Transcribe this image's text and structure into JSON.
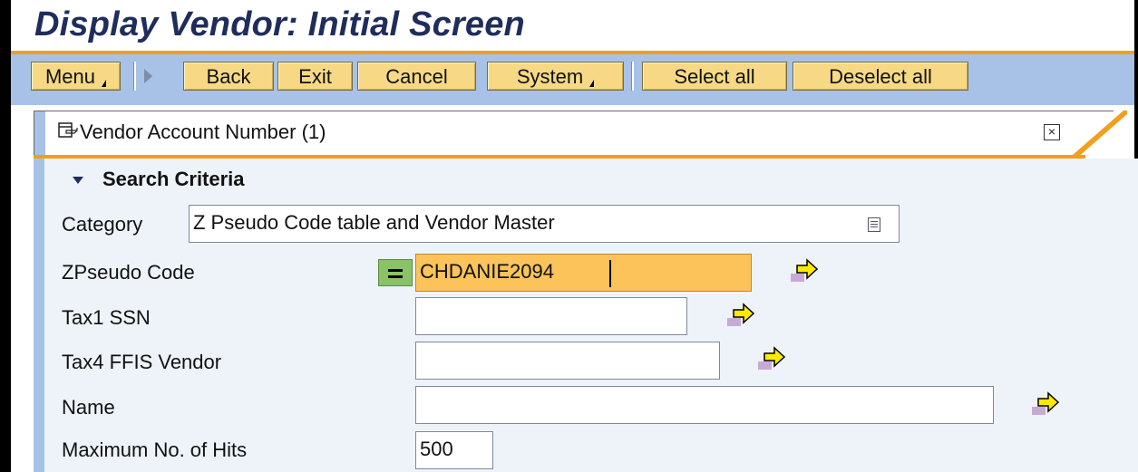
{
  "window": {
    "title": "Display Vendor: Initial Screen"
  },
  "toolbar": {
    "menu_label": "Menu",
    "back_label": "Back",
    "exit_label": "Exit",
    "cancel_label": "Cancel",
    "system_label": "System",
    "select_all_label": "Select all",
    "deselect_all_label": "Deselect all"
  },
  "panel": {
    "header_title": "Vendor Account Number (1)",
    "close_glyph": "×",
    "section_title": "Search Criteria"
  },
  "form": {
    "category_label": "Category",
    "category_value": "Z Pseudo Code table and Vendor Master",
    "zpseudo_label": "ZPseudo Code",
    "zpseudo_value": "CHDANIE2094",
    "tax1_label": "Tax1 SSN",
    "tax1_value": "",
    "tax4_label": "Tax4 FFIS Vendor",
    "tax4_value": "",
    "name_label": "Name",
    "name_value": "",
    "maxhits_label": "Maximum No. of Hits",
    "maxhits_value": "500"
  },
  "colors": {
    "title_text": "#1f2d5c",
    "accent_orange": "#f19f1c",
    "toolbar_bg": "#a7c2e6",
    "button_bg": "#f7d985",
    "active_field_bg": "#fbc35a",
    "panel_body_bg": "#eef3fa"
  },
  "icons": {
    "popup": "popup-window-icon",
    "close": "close-icon",
    "expand": "triangle-down-icon",
    "category_select": "list-select-icon",
    "equals": "equals-operator-icon",
    "multiple_selection": "multiple-selection-arrow-icon"
  }
}
